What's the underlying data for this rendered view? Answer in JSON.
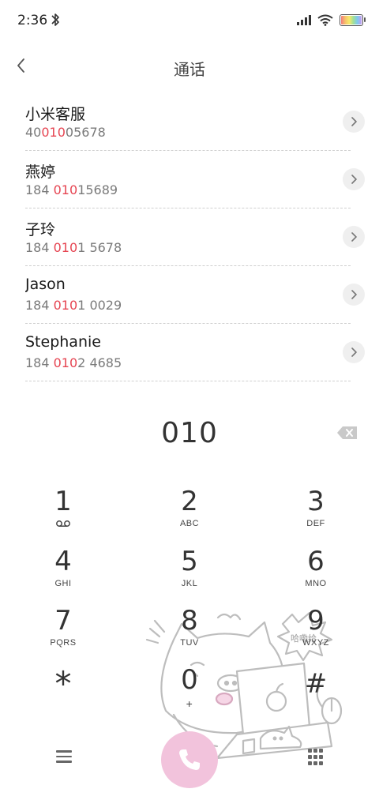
{
  "status_bar": {
    "time": "2:36",
    "icons": [
      "bluetooth-icon",
      "signal-icon",
      "wifi-icon",
      "battery-icon"
    ]
  },
  "header": {
    "title": "通话",
    "back_icon": "chevron-left-icon"
  },
  "results": [
    {
      "name": "小米客服",
      "number_prefix": "40",
      "number_match": "010",
      "number_suffix": "05678"
    },
    {
      "name": "燕婷",
      "number_prefix": "184 ",
      "number_match": "010",
      "number_suffix": "15689"
    },
    {
      "name": "子玲",
      "number_prefix": "184 ",
      "number_match": "010",
      "number_suffix": "1 5678"
    },
    {
      "name": "Jason",
      "number_prefix": "184 ",
      "number_match": "010",
      "number_suffix": "1 0029"
    },
    {
      "name": "Stephanie",
      "number_prefix": "184 ",
      "number_match": "010",
      "number_suffix": "2 4685"
    }
  ],
  "dial": {
    "input": "010",
    "backspace_icon": "backspace-icon"
  },
  "keypad": [
    {
      "digit": "1",
      "letters": ""
    },
    {
      "digit": "2",
      "letters": "ABC"
    },
    {
      "digit": "3",
      "letters": "DEF"
    },
    {
      "digit": "4",
      "letters": "GHI"
    },
    {
      "digit": "5",
      "letters": "JKL"
    },
    {
      "digit": "6",
      "letters": "MNO"
    },
    {
      "digit": "7",
      "letters": "PQRS"
    },
    {
      "digit": "8",
      "letters": "TUV"
    },
    {
      "digit": "9",
      "letters": "WXYZ"
    },
    {
      "digit": "*",
      "letters": ""
    },
    {
      "digit": "0",
      "letters": "+"
    },
    {
      "digit": "#",
      "letters": ""
    }
  ],
  "bottom_bar": {
    "menu_icon": "hamburger-menu-icon",
    "call_icon": "phone-icon",
    "keypad_toggle_icon": "dialpad-grid-icon"
  },
  "colors": {
    "match_highlight": "#e64552",
    "call_button": "#f2c3dc",
    "arrow_bg": "#efefef"
  },
  "illustration_text": "哈嘞给"
}
